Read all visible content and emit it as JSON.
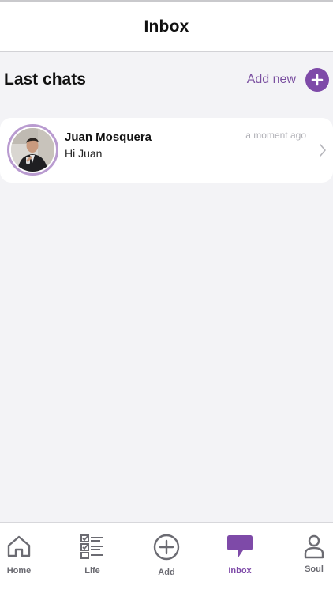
{
  "header": {
    "title": "Inbox"
  },
  "section": {
    "title": "Last chats",
    "add_new_label": "Add new"
  },
  "chats": [
    {
      "name": "Juan Mosquera",
      "preview": "Hi Juan",
      "time": "a moment ago"
    }
  ],
  "nav": {
    "items": [
      {
        "label": "Home",
        "icon": "home-icon",
        "active": false
      },
      {
        "label": "Life",
        "icon": "checklist-icon",
        "active": false
      },
      {
        "label": "Add",
        "icon": "add-circle-icon",
        "active": false
      },
      {
        "label": "Inbox",
        "icon": "chat-bubble-icon",
        "active": true
      },
      {
        "label": "Soul",
        "icon": "user-icon",
        "active": false
      }
    ]
  },
  "colors": {
    "accent": "#7e4aa8",
    "background": "#f3f3f6",
    "card": "#ffffff",
    "inactive_nav": "#6b6b72"
  }
}
